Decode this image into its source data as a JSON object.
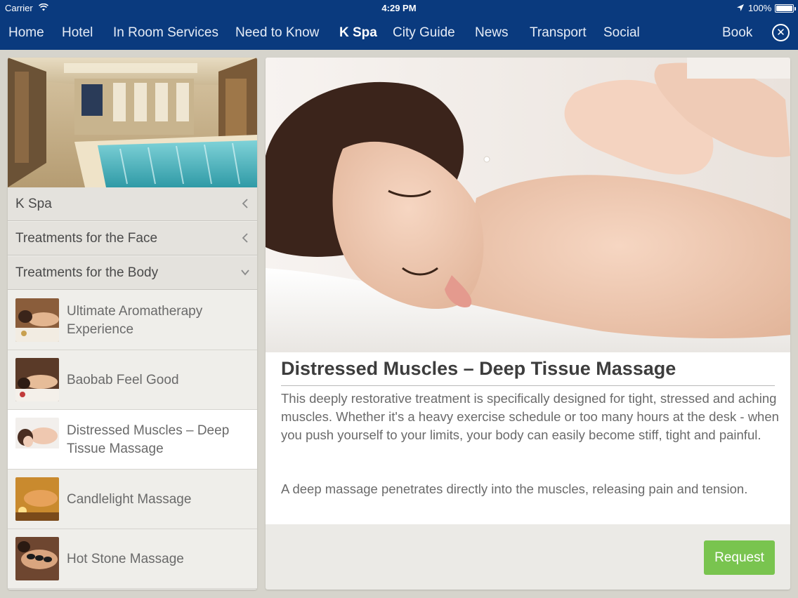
{
  "status_bar": {
    "carrier": "Carrier",
    "time": "4:29 PM",
    "battery": "100%"
  },
  "nav": {
    "items": [
      {
        "label": "Home"
      },
      {
        "label": "Hotel"
      },
      {
        "label": "In Room Services"
      },
      {
        "label": "Need to Know"
      },
      {
        "label": "K Spa",
        "active": true
      },
      {
        "label": "City Guide"
      },
      {
        "label": "News"
      },
      {
        "label": "Transport"
      },
      {
        "label": "Social"
      }
    ],
    "book_label": "Book",
    "close_icon": "close-circle-icon"
  },
  "sidebar": {
    "menu": [
      {
        "label": "K Spa",
        "icon": "chevron-left-icon"
      },
      {
        "label": "Treatments for the Face",
        "icon": "chevron-left-icon"
      },
      {
        "label": "Treatments for the Body",
        "icon": "chevron-down-icon"
      }
    ],
    "items": [
      {
        "label": "Ultimate Aromatherapy Experience"
      },
      {
        "label": "Baobab Feel Good"
      },
      {
        "label": "Distressed Muscles – Deep Tissue Massage",
        "selected": true
      },
      {
        "label": "Candlelight Massage"
      },
      {
        "label": "Hot Stone Massage"
      }
    ]
  },
  "detail": {
    "title": "Distressed Muscles – Deep Tissue Massage",
    "paragraph1": "This deeply restorative treatment is specifically designed for tight, stressed and aching muscles. Whether it's a heavy exercise schedule or too many hours at the desk - when you push yourself to your limits, your body can easily become stiff, tight and painful.",
    "paragraph2": "A deep massage penetrates directly into the muscles, releasing pain and tension.",
    "request_label": "Request"
  },
  "colors": {
    "nav_bg": "#0a3a7e",
    "request_green": "#79c44f",
    "selected_row": "#ffffff"
  }
}
